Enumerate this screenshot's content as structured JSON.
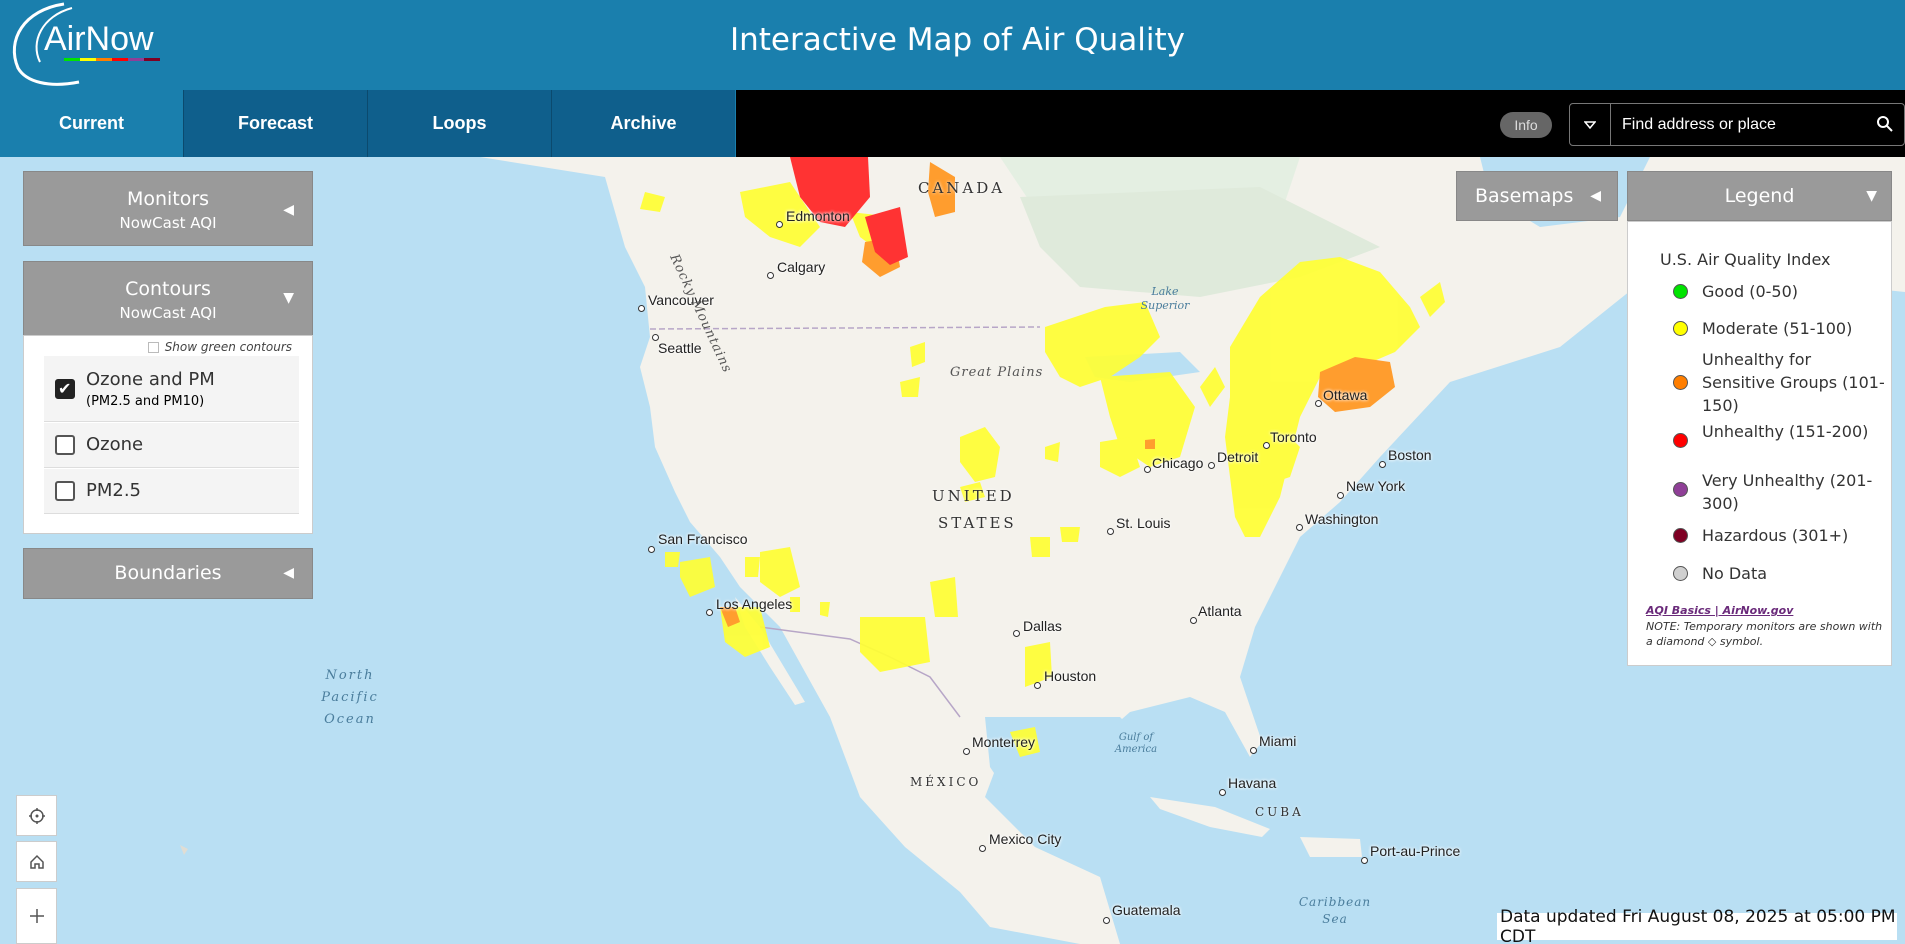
{
  "header": {
    "logo_text": "AirNow",
    "title": "Interactive Map of Air Quality"
  },
  "nav": {
    "tabs": [
      {
        "label": "Current",
        "active": true
      },
      {
        "label": "Forecast",
        "active": false
      },
      {
        "label": "Loops",
        "active": false
      },
      {
        "label": "Archive",
        "active": false
      }
    ],
    "info_label": "Info",
    "search_placeholder": "Find address or place",
    "icons": [
      "chevron-down-icon",
      "search-icon"
    ]
  },
  "panels": {
    "monitors": {
      "title": "Monitors",
      "subtitle": "NowCast AQI",
      "expanded": false
    },
    "contours": {
      "title": "Contours",
      "subtitle": "NowCast AQI",
      "expanded": true,
      "show_green_label": "Show green contours",
      "show_green_checked": false,
      "options": [
        {
          "label": "Ozone and PM",
          "sublabel": "(PM2.5 and PM10)",
          "checked": true
        },
        {
          "label": "Ozone",
          "sublabel": "",
          "checked": false
        },
        {
          "label": "PM2.5",
          "sublabel": "",
          "checked": false
        }
      ]
    },
    "boundaries": {
      "title": "Boundaries",
      "expanded": false
    }
  },
  "basemaps": {
    "title": "Basemaps"
  },
  "legend": {
    "header": "Legend",
    "title": "U.S. Air Quality Index",
    "items": [
      {
        "label": "Good (0-50)",
        "color": "#00e400"
      },
      {
        "label": "Moderate (51-100)",
        "color": "#ffff00"
      },
      {
        "label": "Unhealthy for Sensitive Groups (101-150)",
        "color": "#ff7e00"
      },
      {
        "label": "Unhealthy (151-200)",
        "color": "#ff0000"
      },
      {
        "label": "Very Unhealthy (201-300)",
        "color": "#8f3f97"
      },
      {
        "label": "Hazardous (301+)",
        "color": "#7e0023"
      },
      {
        "label": "No Data",
        "color": "#d0d0d0"
      }
    ],
    "link": "AQI Basics | AirNow.gov",
    "note": "NOTE: Temporary monitors are shown with a diamond ◇ symbol."
  },
  "map": {
    "countries": [
      "CANADA",
      "UNITED",
      "STATES",
      "MÉXICO",
      "CUBA"
    ],
    "water": [
      "North Pacific Ocean",
      "Lake Superior",
      "Gulf of America",
      "Caribbean Sea"
    ],
    "regions": [
      "Rocky Mountains",
      "Great Plains"
    ],
    "cities": [
      "Edmonton",
      "Calgary",
      "Vancouver",
      "Seattle",
      "San Francisco",
      "Los Angeles",
      "Dallas",
      "Houston",
      "Monterrey",
      "Mexico City",
      "Guatemala",
      "Chicago",
      "Detroit",
      "St. Louis",
      "Toronto",
      "Ottawa",
      "Boston",
      "New York",
      "Washington",
      "Atlanta",
      "Miami",
      "Havana",
      "Port-au-Prince"
    ],
    "controls": [
      "locate-icon",
      "home-icon",
      "zoom-in-icon"
    ]
  },
  "status": {
    "updated": "Data updated Fri August 08, 2025 at 05:00 PM CDT"
  }
}
